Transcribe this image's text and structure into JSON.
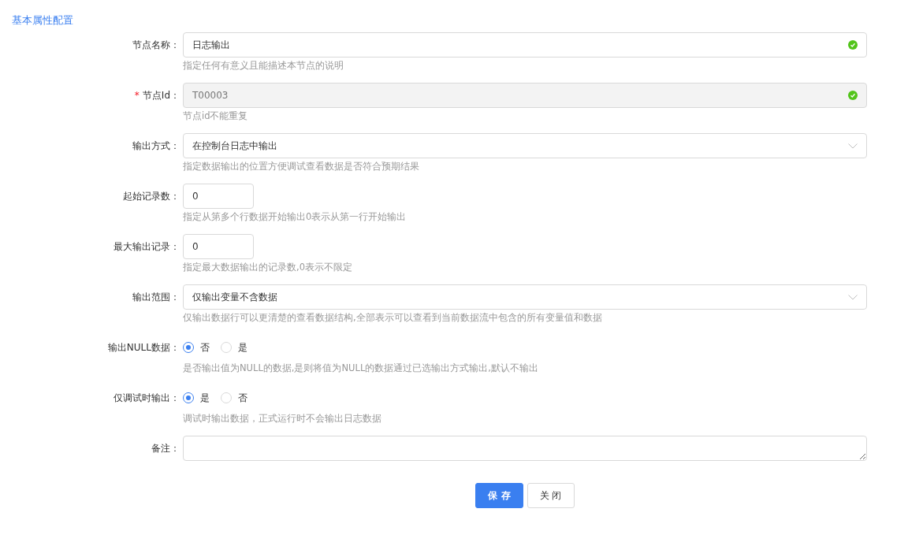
{
  "section_title": "基本属性配置",
  "fields": [
    {
      "kind": "text",
      "label": "节点名称：",
      "value": "日志输出",
      "disabled": false,
      "valid": true,
      "hint": "指定任何有意义且能描述本节点的说明"
    },
    {
      "kind": "text",
      "required_mark": "*",
      "label": "节点Id：",
      "value": "T00003",
      "disabled": true,
      "valid": true,
      "hint": "节点id不能重复"
    },
    {
      "kind": "select",
      "label": "输出方式：",
      "value": "在控制台日志中输出",
      "hint": "指定数据输出的位置方便调试查看数据是否符合预期结果"
    },
    {
      "kind": "number",
      "label": "起始记录数：",
      "value": "0",
      "hint": "指定从第多个行数据开始输出0表示从第一行开始输出"
    },
    {
      "kind": "number",
      "label": "最大输出记录：",
      "value": "0",
      "hint": "指定最大数据输出的记录数,0表示不限定"
    },
    {
      "kind": "select",
      "label": "输出范围：",
      "value": "仅输出变量不含数据",
      "hint": "仅输出数据行可以更清楚的查看数据结构,全部表示可以查看到当前数据流中包含的所有变量值和数据"
    },
    {
      "kind": "radio",
      "label": "输出NULL数据：",
      "options": [
        {
          "label": "否",
          "selected": true
        },
        {
          "label": "是",
          "selected": false
        }
      ],
      "hint": "是否输出值为NULL的数据,是则将值为NULL的数据通过已选输出方式输出,默认不输出"
    },
    {
      "kind": "radio",
      "label": "仅调试时输出：",
      "options": [
        {
          "label": "是",
          "selected": true
        },
        {
          "label": "否",
          "selected": false
        }
      ],
      "hint": "调试时输出数据，正式运行时不会输出日志数据"
    },
    {
      "kind": "textarea",
      "label": "备注："
    }
  ],
  "buttons": [
    {
      "label": "保 存",
      "primary": true
    },
    {
      "label": "关 闭",
      "primary": false
    }
  ]
}
